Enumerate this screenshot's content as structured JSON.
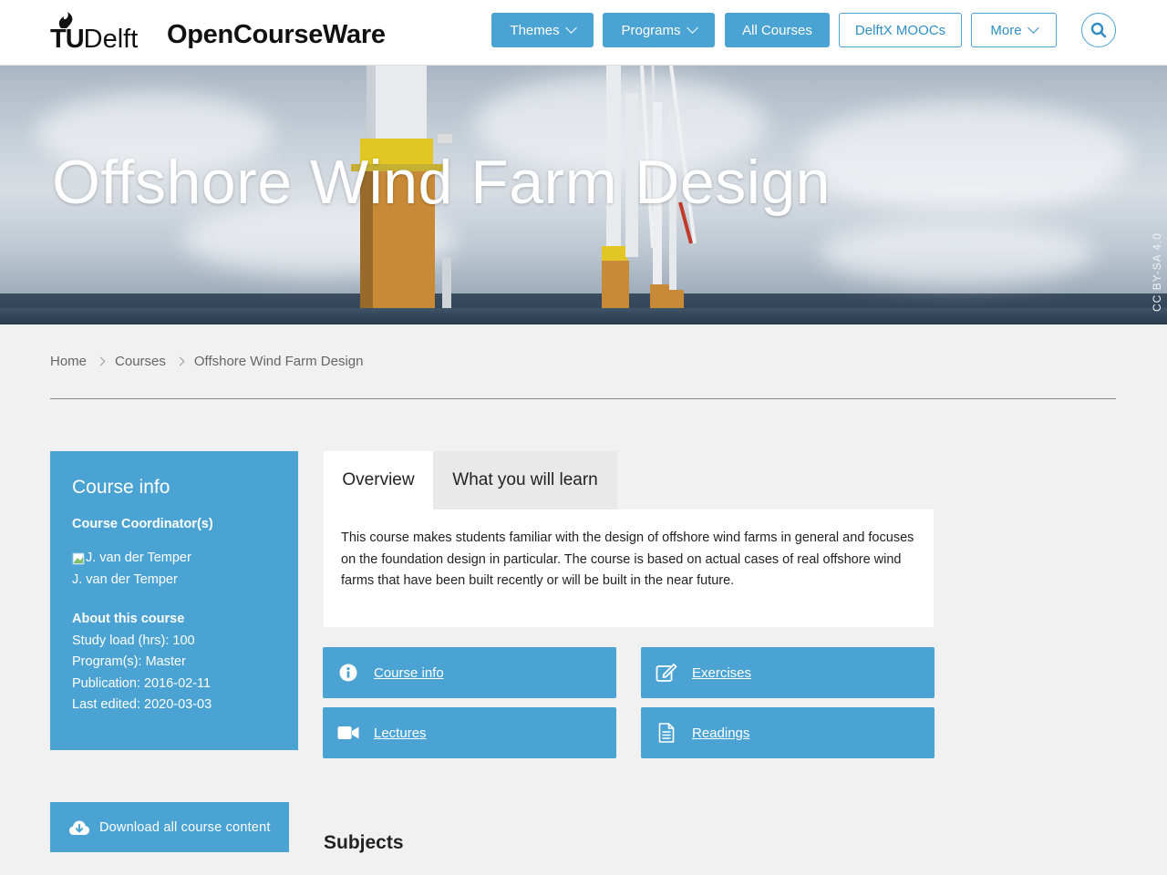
{
  "header": {
    "logo_tu": "TU",
    "logo_delft": "Delft",
    "site_title": "OpenCourseWare",
    "nav": [
      {
        "label": "Themes",
        "has_dropdown": true,
        "style": "filled"
      },
      {
        "label": "Programs",
        "has_dropdown": true,
        "style": "filled"
      },
      {
        "label": "All Courses",
        "has_dropdown": false,
        "style": "filled"
      },
      {
        "label": "DelftX MOOCs",
        "has_dropdown": false,
        "style": "outline"
      },
      {
        "label": "More",
        "has_dropdown": true,
        "style": "outline"
      }
    ],
    "search_icon": "search-icon"
  },
  "hero": {
    "title": "Offshore Wind Farm Design",
    "license": "CC BY-SA 4.0"
  },
  "breadcrumb": [
    "Home",
    "Courses",
    "Offshore Wind Farm Design"
  ],
  "course_info": {
    "heading": "Course info",
    "coordinator_label": "Course Coordinator(s)",
    "coordinator_image_alt": "J. van der Temper",
    "coordinator_name": "J. van der Temper",
    "about_label": "About this course",
    "study_load": "Study load (hrs): 100",
    "programs": "Program(s): Master",
    "publication": "Publication: 2016-02-11",
    "last_edited": "Last edited: 2020-03-03"
  },
  "download": {
    "label": "Download all course content",
    "icon": "cloud-download-icon"
  },
  "tabs": [
    {
      "label": "Overview",
      "active": true
    },
    {
      "label": "What you will learn",
      "active": false
    }
  ],
  "overview_text": "This course makes students familiar with the design of offshore wind farms in general and focuses on the foundation design in particular. The course is based on actual cases of real offshore wind farms that have been built recently or will be built in the near future.",
  "tiles": [
    {
      "label": "Course info",
      "icon": "info-icon"
    },
    {
      "label": "Exercises",
      "icon": "edit-icon"
    },
    {
      "label": "Lectures",
      "icon": "video-camera-icon"
    },
    {
      "label": "Readings",
      "icon": "document-icon"
    }
  ],
  "subjects_heading": "Subjects",
  "colors": {
    "accent": "#4aa3d3",
    "accent_text": "#2f8ec4",
    "background": "#f1f1f1"
  }
}
